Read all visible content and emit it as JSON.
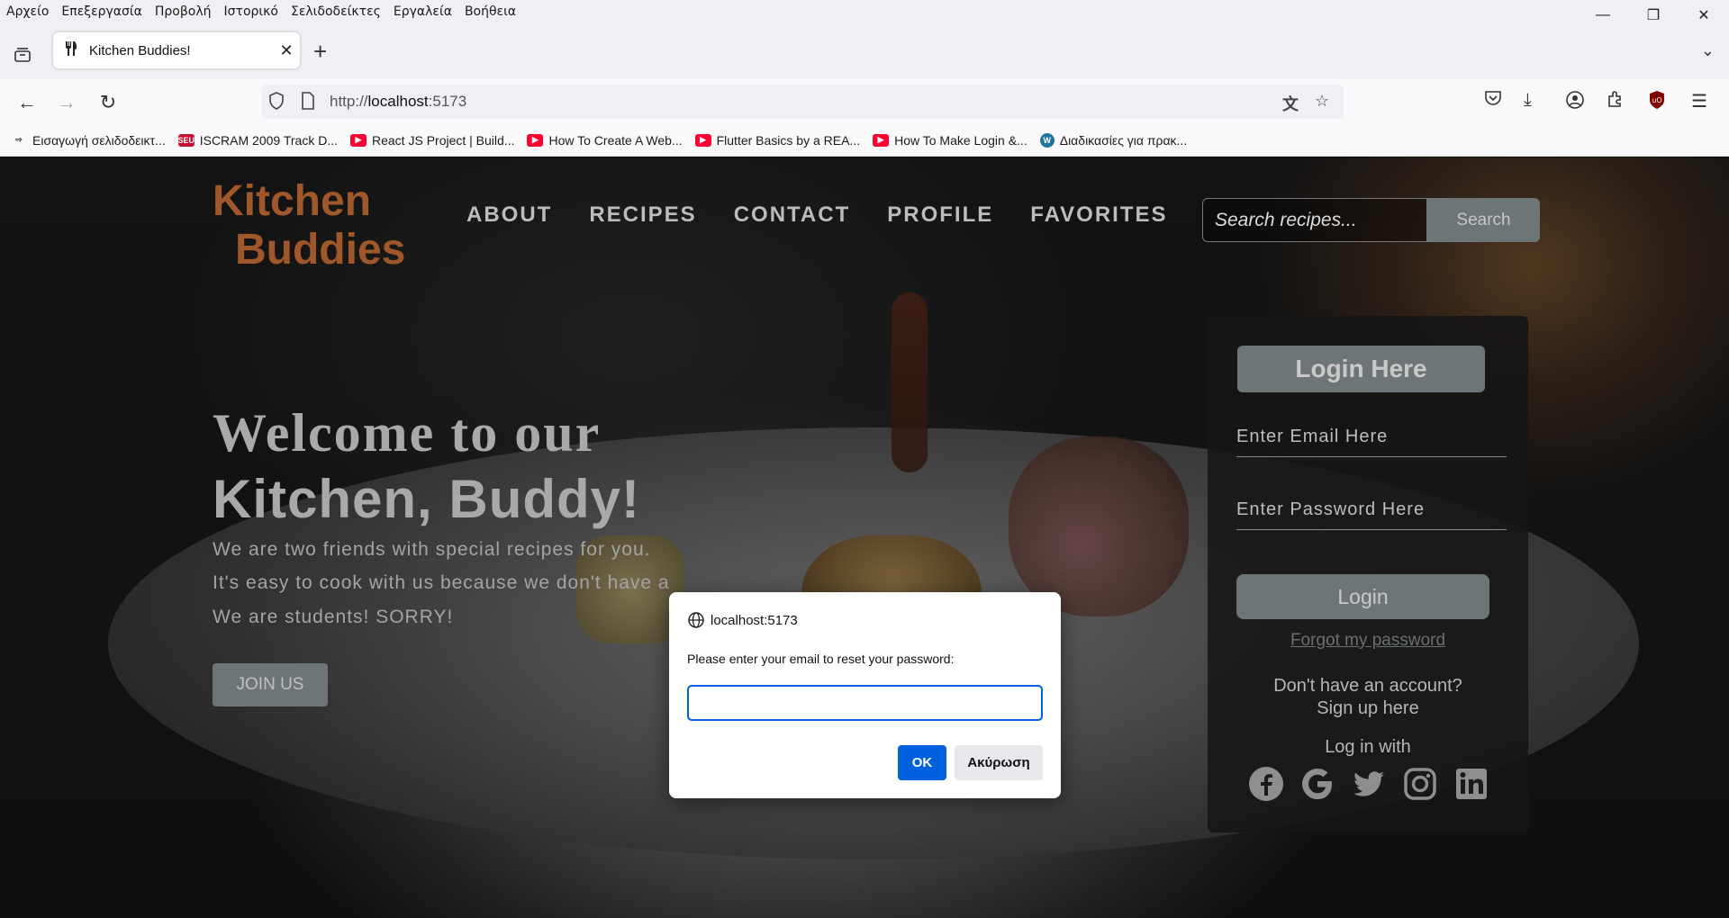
{
  "menubar": {
    "items": [
      "Αρχείο",
      "Επεξεργασία",
      "Προβολή",
      "Ιστορικό",
      "Σελιδοδείκτες",
      "Εργαλεία",
      "Βοήθεια"
    ]
  },
  "tab": {
    "title": "Kitchen Buddies!"
  },
  "url": {
    "scheme": "http://",
    "host": "localhost",
    "port": ":5173"
  },
  "bookmarks": [
    {
      "label": "Εισαγωγή σελιδοδεικτ...",
      "icon": "import-icon",
      "color": "#333333"
    },
    {
      "label": "ISCRAM 2009 Track D...",
      "icon": "seu-icon",
      "color": "#c8102e"
    },
    {
      "label": "React JS Project | Build...",
      "icon": "youtube-icon",
      "color": "#ff0033"
    },
    {
      "label": "How To Create A Web...",
      "icon": "youtube-icon",
      "color": "#ff0033"
    },
    {
      "label": "Flutter Basics by a REA...",
      "icon": "youtube-icon",
      "color": "#ff0033"
    },
    {
      "label": "How To Make Login &...",
      "icon": "youtube-icon",
      "color": "#ff0033"
    },
    {
      "label": "Διαδικασίες για πρακ...",
      "icon": "wordpress-icon",
      "color": "#21759b"
    }
  ],
  "site": {
    "logo_line1": "Kitchen",
    "logo_line2": "Buddies",
    "logo_color": "#a0582a",
    "nav": [
      "ABOUT",
      "RECIPES",
      "CONTACT",
      "PROFILE",
      "FAVORITES"
    ],
    "search_placeholder": "Search recipes...",
    "search_button": "Search",
    "hero_line1": "Welcome to our",
    "hero_line2": "Kitchen, Buddy!",
    "hero_p1": "We are two friends with special recipes for you.",
    "hero_p2": "It's easy to cook with us because we don't have a",
    "hero_p3": "We are students! SORRY!",
    "join_button": "JOIN US"
  },
  "login": {
    "title": "Login Here",
    "email_placeholder": "Enter Email Here",
    "password_placeholder": "Enter Password Here",
    "login_button": "Login",
    "forgot": "Forgot my password",
    "no_account": "Don't have an account?",
    "signup": "Sign up here",
    "log_in_with": "Log in with",
    "socials": [
      "facebook-icon",
      "google-icon",
      "twitter-icon",
      "instagram-icon",
      "linkedin-icon"
    ]
  },
  "dialog": {
    "origin": "localhost:5173",
    "message": "Please enter your email to reset your password:",
    "input_value": "",
    "ok": "OK",
    "cancel": "Ακύρωση",
    "accent": "#0061e0"
  }
}
